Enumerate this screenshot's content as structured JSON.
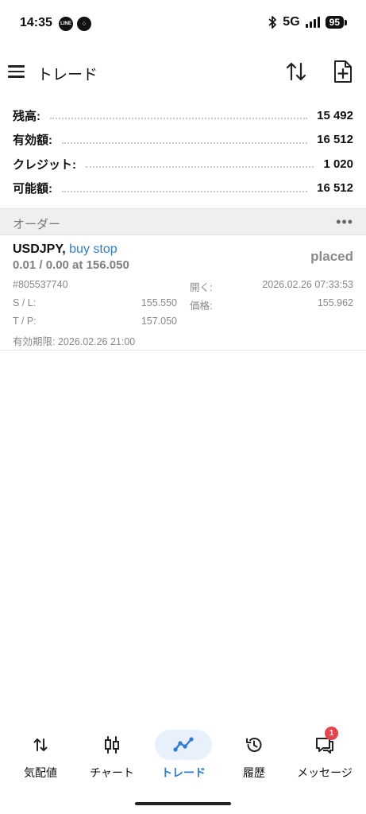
{
  "status_bar": {
    "time": "14:35",
    "app_icon_1": "LINE",
    "app_icon_2": "⁘",
    "network": "5G",
    "battery": "95"
  },
  "header": {
    "title": "トレード"
  },
  "account": {
    "balance_label": "残高:",
    "balance_value": "15 492",
    "equity_label": "有効額:",
    "equity_value": "16 512",
    "credit_label": "クレジット:",
    "credit_value": "1 020",
    "free_margin_label": "可能額:",
    "free_margin_value": "16 512"
  },
  "orders": {
    "section_title": "オーダー",
    "more_label": "•••",
    "items": [
      {
        "symbol": "USDJPY,",
        "type": "buy stop",
        "volume": "0.01 / 0.00 at 156.050",
        "status": "placed",
        "id": "#805537740",
        "open_label": "開く:",
        "open_time": "2026.02.26 07:33:53",
        "sl_label": "S / L:",
        "sl_value": "155.550",
        "price_label": "価格:",
        "price_value": "155.962",
        "tp_label": "T / P:",
        "tp_value": "157.050",
        "expiry": "有効期限: 2026.02.26 21:00"
      }
    ]
  },
  "nav": {
    "quotes": "気配値",
    "chart": "チャート",
    "trade": "トレード",
    "history": "履歴",
    "messages": "メッセージ",
    "messages_badge": "1"
  },
  "colors": {
    "accent": "#2d7cd6",
    "badge": "#e8434a",
    "section_bg": "#efefef"
  }
}
